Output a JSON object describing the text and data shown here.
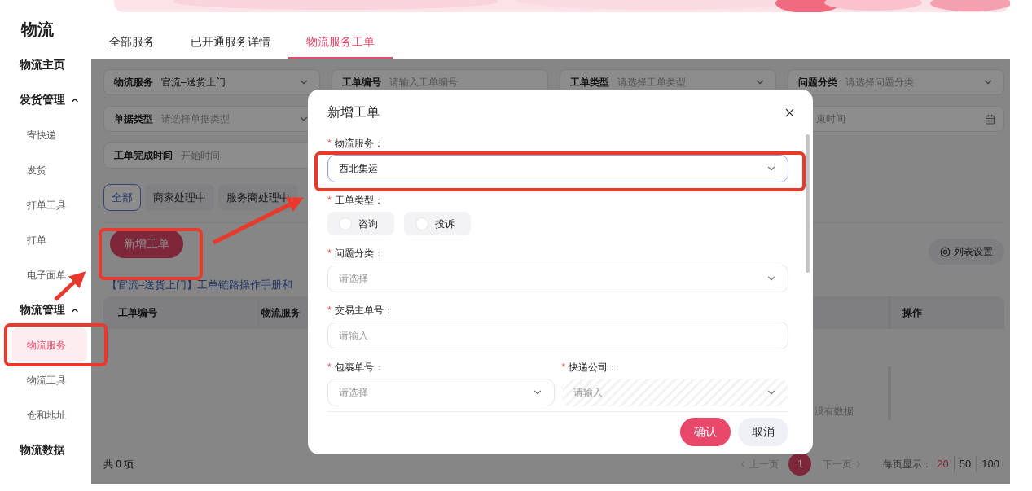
{
  "sidebar": {
    "title": "物流",
    "items": [
      {
        "kind": "link",
        "label": "物流主页"
      },
      {
        "kind": "group",
        "label": "发货管理",
        "expanded": true,
        "children": [
          {
            "label": "寄快递",
            "selected": false
          },
          {
            "label": "发货",
            "selected": false
          },
          {
            "label": "打单工具",
            "selected": false
          },
          {
            "label": "打单",
            "selected": false
          },
          {
            "label": "电子面单",
            "selected": false
          }
        ]
      },
      {
        "kind": "group",
        "label": "物流管理",
        "expanded": true,
        "children": [
          {
            "label": "物流服务",
            "selected": true
          },
          {
            "label": "物流工具",
            "selected": false
          },
          {
            "label": "仓和地址",
            "selected": false
          }
        ]
      },
      {
        "kind": "link",
        "label": "物流数据"
      }
    ]
  },
  "tabs": [
    {
      "label": "全部服务",
      "selected": false
    },
    {
      "label": "已开通服务详情",
      "selected": false
    },
    {
      "label": "物流服务工单",
      "selected": true
    }
  ],
  "filter_rows": [
    [
      {
        "kind": "select",
        "label": "物流服务",
        "value": "官流–送货上门"
      },
      {
        "kind": "input",
        "label": "工单编号",
        "placeholder": "请输入工单编号"
      },
      {
        "kind": "select",
        "label": "工单类型",
        "placeholder": "请选择工单类型"
      },
      {
        "kind": "select",
        "label": "问题分类",
        "placeholder": "请选择问题分类"
      }
    ],
    [
      {
        "kind": "select",
        "label": "单据类型",
        "placeholder": "请选择单据类型"
      },
      {
        "kind": "date_end",
        "placeholder": "束时间"
      }
    ],
    [
      {
        "kind": "date_start",
        "label": "工单完成时间",
        "placeholder": "开始时间"
      }
    ]
  ],
  "status_filters": [
    {
      "label": "全部",
      "selected": true
    },
    {
      "label": "商家处理中",
      "selected": false
    },
    {
      "label": "服务商处理中",
      "selected": false
    }
  ],
  "create_button": "新增工单",
  "settings_button": "列表设置",
  "manual_link": "【官流–送货上门】工单链路操作手册和",
  "table": {
    "columns": [
      "工单编号",
      "物流服务",
      "操作"
    ],
    "empty_text": "没有数据"
  },
  "total": "共 0 项",
  "pagination": {
    "prev": "上一页",
    "pages": [
      {
        "label": "1",
        "selected": true
      }
    ],
    "next": "下一页",
    "page_size_label": "每页显示：",
    "page_sizes": [
      {
        "label": "20",
        "selected": true
      },
      {
        "label": "50",
        "selected": false
      },
      {
        "label": "100",
        "selected": false
      }
    ]
  },
  "dialog": {
    "title": "新增工单",
    "rows": [
      [
        {
          "kind": "select",
          "required_mark": "*",
          "label": "物流服务：",
          "value": "西北集运",
          "focused": true
        }
      ],
      [
        {
          "kind": "radio",
          "required_mark": "*",
          "label": "工单类型：",
          "options": [
            {
              "label": "咨询",
              "selected": false
            },
            {
              "label": "投诉",
              "selected": false
            }
          ]
        }
      ],
      [
        {
          "kind": "select",
          "required_mark": "*",
          "label": "问题分类：",
          "placeholder": "请选择",
          "focused": false
        }
      ],
      [
        {
          "kind": "input",
          "required_mark": "*",
          "label": "交易主单号：",
          "placeholder": "请输入"
        }
      ],
      [
        {
          "kind": "select",
          "required_mark": "*",
          "label": "包裹单号：",
          "placeholder": "请选择",
          "focused": false
        },
        {
          "kind": "select",
          "required_mark": "*",
          "label": "快递公司：",
          "placeholder": "请输入",
          "disabled": true,
          "focused": false
        }
      ]
    ],
    "buttons": [
      {
        "kind": "primary",
        "label": "确认"
      },
      {
        "kind": "secondary",
        "label": "取消"
      }
    ]
  }
}
